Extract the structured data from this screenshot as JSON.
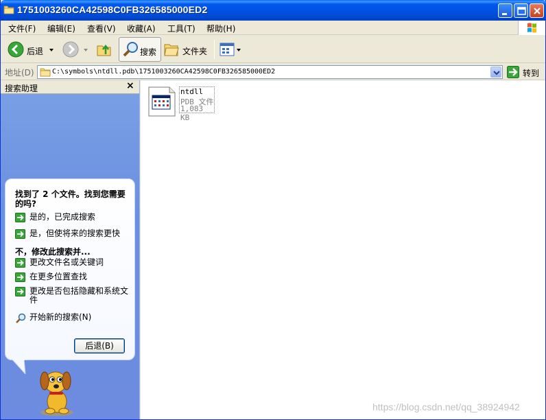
{
  "window": {
    "title": "1751003260CA42598C0FB326585000ED2",
    "accent": "#0054e3"
  },
  "menu": {
    "items": [
      "文件(F)",
      "编辑(E)",
      "查看(V)",
      "收藏(A)",
      "工具(T)",
      "帮助(H)"
    ]
  },
  "toolbar": {
    "back_label": "后退",
    "search_label": "搜索",
    "folders_label": "文件夹"
  },
  "address": {
    "label": "地址(D)",
    "value": "C:\\symbols\\ntdll.pdb\\1751003260CA42598C0FB326585000ED2",
    "go_label": "转到"
  },
  "search_pane": {
    "title": "搜索助理",
    "close_glyph": "×",
    "question": "找到了 2 个文件。找到您需要的吗?",
    "options_yes": [
      "是的，已完成搜索",
      "是，但使将来的搜索更快"
    ],
    "subtitle": "不，修改此搜索并...",
    "options_modify": [
      "更改文件名或关键词",
      "在更多位置查找",
      "更改是否包括隐藏和系统文件"
    ],
    "new_search": "开始新的搜索(N)",
    "back_button": "后退(B)"
  },
  "files": [
    {
      "name": "ntdll",
      "type": "PDB 文件",
      "size": "1,083 KB"
    }
  ],
  "watermark": "https://blog.csdn.net/qq_38924942"
}
